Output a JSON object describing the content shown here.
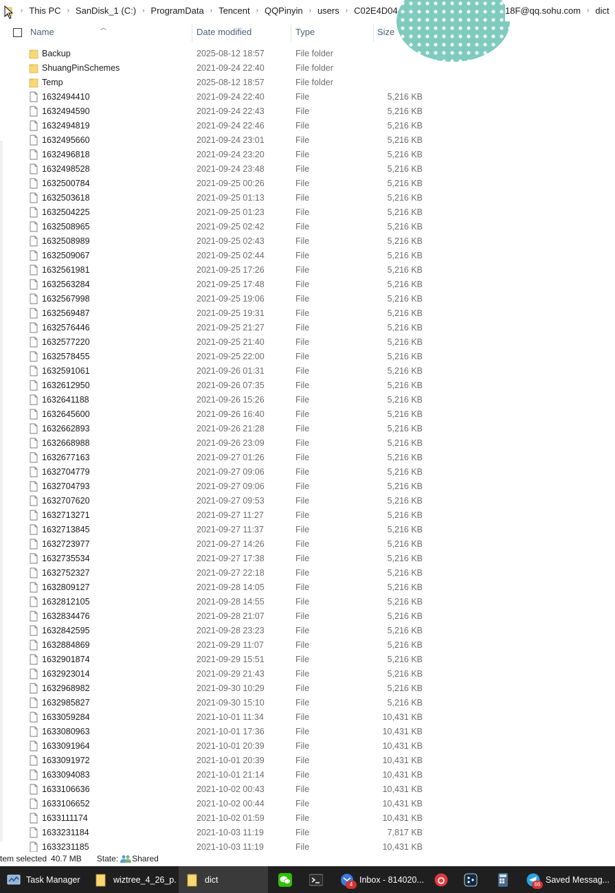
{
  "breadcrumb": [
    "This PC",
    "SanDisk_1 (C:)",
    "ProgramData",
    "Tencent",
    "QQPinyin",
    "users",
    "C02E4D04",
    "18F@qq.sohu.com",
    "dict"
  ],
  "columns": {
    "name": "Name",
    "date": "Date modified",
    "type": "Type",
    "size": "Size"
  },
  "files": [
    {
      "name": "Backup",
      "date": "2025-08-12 18:57",
      "type": "File folder",
      "size": "",
      "kind": "folder"
    },
    {
      "name": "ShuangPinSchemes",
      "date": "2021-09-24 22:40",
      "type": "File folder",
      "size": "",
      "kind": "folder"
    },
    {
      "name": "Temp",
      "date": "2025-08-12 18:57",
      "type": "File folder",
      "size": "",
      "kind": "folder"
    },
    {
      "name": "1632494410",
      "date": "2021-09-24 22:40",
      "type": "File",
      "size": "5,216 KB",
      "kind": "file"
    },
    {
      "name": "1632494590",
      "date": "2021-09-24 22:43",
      "type": "File",
      "size": "5,216 KB",
      "kind": "file"
    },
    {
      "name": "1632494819",
      "date": "2021-09-24 22:46",
      "type": "File",
      "size": "5,216 KB",
      "kind": "file"
    },
    {
      "name": "1632495660",
      "date": "2021-09-24 23:01",
      "type": "File",
      "size": "5,216 KB",
      "kind": "file"
    },
    {
      "name": "1632496818",
      "date": "2021-09-24 23:20",
      "type": "File",
      "size": "5,216 KB",
      "kind": "file"
    },
    {
      "name": "1632498528",
      "date": "2021-09-24 23:48",
      "type": "File",
      "size": "5,216 KB",
      "kind": "file"
    },
    {
      "name": "1632500784",
      "date": "2021-09-25 00:26",
      "type": "File",
      "size": "5,216 KB",
      "kind": "file"
    },
    {
      "name": "1632503618",
      "date": "2021-09-25 01:13",
      "type": "File",
      "size": "5,216 KB",
      "kind": "file"
    },
    {
      "name": "1632504225",
      "date": "2021-09-25 01:23",
      "type": "File",
      "size": "5,216 KB",
      "kind": "file"
    },
    {
      "name": "1632508965",
      "date": "2021-09-25 02:42",
      "type": "File",
      "size": "5,216 KB",
      "kind": "file"
    },
    {
      "name": "1632508989",
      "date": "2021-09-25 02:43",
      "type": "File",
      "size": "5,216 KB",
      "kind": "file"
    },
    {
      "name": "1632509067",
      "date": "2021-09-25 02:44",
      "type": "File",
      "size": "5,216 KB",
      "kind": "file"
    },
    {
      "name": "1632561981",
      "date": "2021-09-25 17:26",
      "type": "File",
      "size": "5,216 KB",
      "kind": "file"
    },
    {
      "name": "1632563284",
      "date": "2021-09-25 17:48",
      "type": "File",
      "size": "5,216 KB",
      "kind": "file"
    },
    {
      "name": "1632567998",
      "date": "2021-09-25 19:06",
      "type": "File",
      "size": "5,216 KB",
      "kind": "file"
    },
    {
      "name": "1632569487",
      "date": "2021-09-25 19:31",
      "type": "File",
      "size": "5,216 KB",
      "kind": "file"
    },
    {
      "name": "1632576446",
      "date": "2021-09-25 21:27",
      "type": "File",
      "size": "5,216 KB",
      "kind": "file"
    },
    {
      "name": "1632577220",
      "date": "2021-09-25 21:40",
      "type": "File",
      "size": "5,216 KB",
      "kind": "file"
    },
    {
      "name": "1632578455",
      "date": "2021-09-25 22:00",
      "type": "File",
      "size": "5,216 KB",
      "kind": "file"
    },
    {
      "name": "1632591061",
      "date": "2021-09-26 01:31",
      "type": "File",
      "size": "5,216 KB",
      "kind": "file"
    },
    {
      "name": "1632612950",
      "date": "2021-09-26 07:35",
      "type": "File",
      "size": "5,216 KB",
      "kind": "file"
    },
    {
      "name": "1632641188",
      "date": "2021-09-26 15:26",
      "type": "File",
      "size": "5,216 KB",
      "kind": "file"
    },
    {
      "name": "1632645600",
      "date": "2021-09-26 16:40",
      "type": "File",
      "size": "5,216 KB",
      "kind": "file"
    },
    {
      "name": "1632662893",
      "date": "2021-09-26 21:28",
      "type": "File",
      "size": "5,216 KB",
      "kind": "file"
    },
    {
      "name": "1632668988",
      "date": "2021-09-26 23:09",
      "type": "File",
      "size": "5,216 KB",
      "kind": "file"
    },
    {
      "name": "1632677163",
      "date": "2021-09-27 01:26",
      "type": "File",
      "size": "5,216 KB",
      "kind": "file"
    },
    {
      "name": "1632704779",
      "date": "2021-09-27 09:06",
      "type": "File",
      "size": "5,216 KB",
      "kind": "file"
    },
    {
      "name": "1632704793",
      "date": "2021-09-27 09:06",
      "type": "File",
      "size": "5,216 KB",
      "kind": "file"
    },
    {
      "name": "1632707620",
      "date": "2021-09-27 09:53",
      "type": "File",
      "size": "5,216 KB",
      "kind": "file"
    },
    {
      "name": "1632713271",
      "date": "2021-09-27 11:27",
      "type": "File",
      "size": "5,216 KB",
      "kind": "file"
    },
    {
      "name": "1632713845",
      "date": "2021-09-27 11:37",
      "type": "File",
      "size": "5,216 KB",
      "kind": "file"
    },
    {
      "name": "1632723977",
      "date": "2021-09-27 14:26",
      "type": "File",
      "size": "5,216 KB",
      "kind": "file"
    },
    {
      "name": "1632735534",
      "date": "2021-09-27 17:38",
      "type": "File",
      "size": "5,216 KB",
      "kind": "file"
    },
    {
      "name": "1632752327",
      "date": "2021-09-27 22:18",
      "type": "File",
      "size": "5,216 KB",
      "kind": "file"
    },
    {
      "name": "1632809127",
      "date": "2021-09-28 14:05",
      "type": "File",
      "size": "5,216 KB",
      "kind": "file"
    },
    {
      "name": "1632812105",
      "date": "2021-09-28 14:55",
      "type": "File",
      "size": "5,216 KB",
      "kind": "file"
    },
    {
      "name": "1632834476",
      "date": "2021-09-28 21:07",
      "type": "File",
      "size": "5,216 KB",
      "kind": "file"
    },
    {
      "name": "1632842595",
      "date": "2021-09-28 23:23",
      "type": "File",
      "size": "5,216 KB",
      "kind": "file"
    },
    {
      "name": "1632884869",
      "date": "2021-09-29 11:07",
      "type": "File",
      "size": "5,216 KB",
      "kind": "file"
    },
    {
      "name": "1632901874",
      "date": "2021-09-29 15:51",
      "type": "File",
      "size": "5,216 KB",
      "kind": "file"
    },
    {
      "name": "1632923014",
      "date": "2021-09-29 21:43",
      "type": "File",
      "size": "5,216 KB",
      "kind": "file"
    },
    {
      "name": "1632968982",
      "date": "2021-09-30 10:29",
      "type": "File",
      "size": "5,216 KB",
      "kind": "file"
    },
    {
      "name": "1632985827",
      "date": "2021-09-30 15:10",
      "type": "File",
      "size": "5,216 KB",
      "kind": "file"
    },
    {
      "name": "1633059284",
      "date": "2021-10-01 11:34",
      "type": "File",
      "size": "10,431 KB",
      "kind": "file"
    },
    {
      "name": "1633080963",
      "date": "2021-10-01 17:36",
      "type": "File",
      "size": "10,431 KB",
      "kind": "file"
    },
    {
      "name": "1633091964",
      "date": "2021-10-01 20:39",
      "type": "File",
      "size": "10,431 KB",
      "kind": "file"
    },
    {
      "name": "1633091972",
      "date": "2021-10-01 20:39",
      "type": "File",
      "size": "10,431 KB",
      "kind": "file"
    },
    {
      "name": "1633094083",
      "date": "2021-10-01 21:14",
      "type": "File",
      "size": "10,431 KB",
      "kind": "file"
    },
    {
      "name": "1633106636",
      "date": "2021-10-02 00:43",
      "type": "File",
      "size": "10,431 KB",
      "kind": "file"
    },
    {
      "name": "1633106652",
      "date": "2021-10-02 00:44",
      "type": "File",
      "size": "10,431 KB",
      "kind": "file"
    },
    {
      "name": "1633111174",
      "date": "2021-10-02 01:59",
      "type": "File",
      "size": "10,431 KB",
      "kind": "file"
    },
    {
      "name": "1633231184",
      "date": "2021-10-03 11:19",
      "type": "File",
      "size": "7,817 KB",
      "kind": "file"
    },
    {
      "name": "1633231185",
      "date": "2021-10-03 11:19",
      "type": "File",
      "size": "10,431 KB",
      "kind": "file"
    }
  ],
  "status": {
    "selected": "tem selected",
    "size": "40.7 MB",
    "state_label": "State:",
    "state_value": "Shared"
  },
  "taskbar": [
    {
      "label": "Task Manager",
      "icon": "task-manager-icon",
      "name": "taskbar-task-manager"
    },
    {
      "label": "wiztree_4_26_p...",
      "icon": "folder-icon",
      "name": "taskbar-wiztree"
    },
    {
      "label": "dict",
      "icon": "folder-icon",
      "name": "taskbar-dict",
      "active": true
    },
    {
      "label": "",
      "icon": "wechat-icon",
      "name": "taskbar-wechat"
    },
    {
      "label": "",
      "icon": "terminal-icon",
      "name": "taskbar-terminal"
    },
    {
      "label": "Inbox - 814020...",
      "icon": "mail-icon",
      "name": "taskbar-inbox",
      "badge": "4"
    },
    {
      "label": "",
      "icon": "netease-music-icon",
      "name": "taskbar-music"
    },
    {
      "label": "",
      "icon": "deepl-icon",
      "name": "taskbar-deepl"
    },
    {
      "label": "",
      "icon": "calculator-icon",
      "name": "taskbar-calculator"
    },
    {
      "label": "Saved Messag...",
      "icon": "telegram-icon",
      "name": "taskbar-telegram",
      "badge": "66"
    }
  ],
  "colors": {
    "folder": "#f8d775",
    "header_text": "#4c607a",
    "taskbar_bg": "#1f1f1f",
    "polka_bg": "#7fcbbd"
  }
}
